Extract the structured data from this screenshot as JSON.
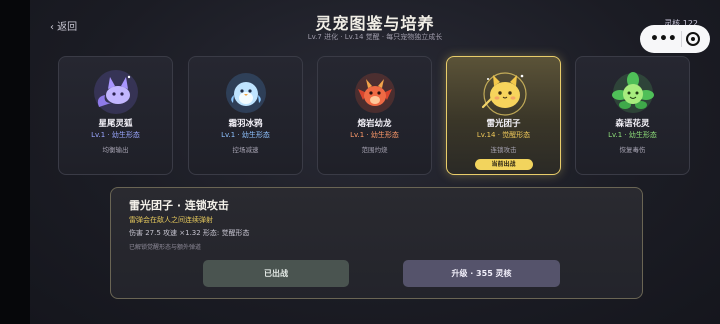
{
  "header": {
    "back_label": "‹ 返回",
    "title": "灵宠图鉴与培养",
    "subtitle": "Lv.7 进化 · Lv.14 觉醒 · 每只宠物独立成长",
    "currency": "灵核 122"
  },
  "capsule": {
    "more_icon": "more-dots-icon",
    "close_icon": "target-icon"
  },
  "pets": [
    {
      "name": "星尾灵狐",
      "level": "Lv.1 · 幼生形态",
      "desc": "均衡输出",
      "level_color": "#9aa6ff",
      "icon": "fox-icon"
    },
    {
      "name": "霜羽冰鸦",
      "level": "Lv.1 · 幼生形态",
      "desc": "控场减速",
      "level_color": "#8fc2ff",
      "icon": "ice-bird-icon"
    },
    {
      "name": "熔岩幼龙",
      "level": "Lv.1 · 幼生形态",
      "desc": "范围灼烧",
      "level_color": "#ff9a6a",
      "icon": "dragon-icon"
    },
    {
      "name": "雷光团子",
      "level": "Lv.14 · 觉醒形态",
      "desc": "连锁攻击",
      "level_color": "#f0c95a",
      "icon": "thunder-cat-icon",
      "badge": "当前出战"
    },
    {
      "name": "森语花灵",
      "level": "Lv.1 · 幼生形态",
      "desc": "恢复毒伤",
      "level_color": "#8fe07a",
      "icon": "flower-sprite-icon"
    }
  ],
  "detail": {
    "title": "雷光团子 · 连锁攻击",
    "desc": "雷弹会在敌人之间连续弹射",
    "stats": "伤害 27.5   攻速 ×1.32   形态: 觉醒形态",
    "note": "已解锁觉醒形态与额外弹道",
    "deployed_label": "已出战",
    "upgrade_label": "升级 · 355 灵核"
  }
}
